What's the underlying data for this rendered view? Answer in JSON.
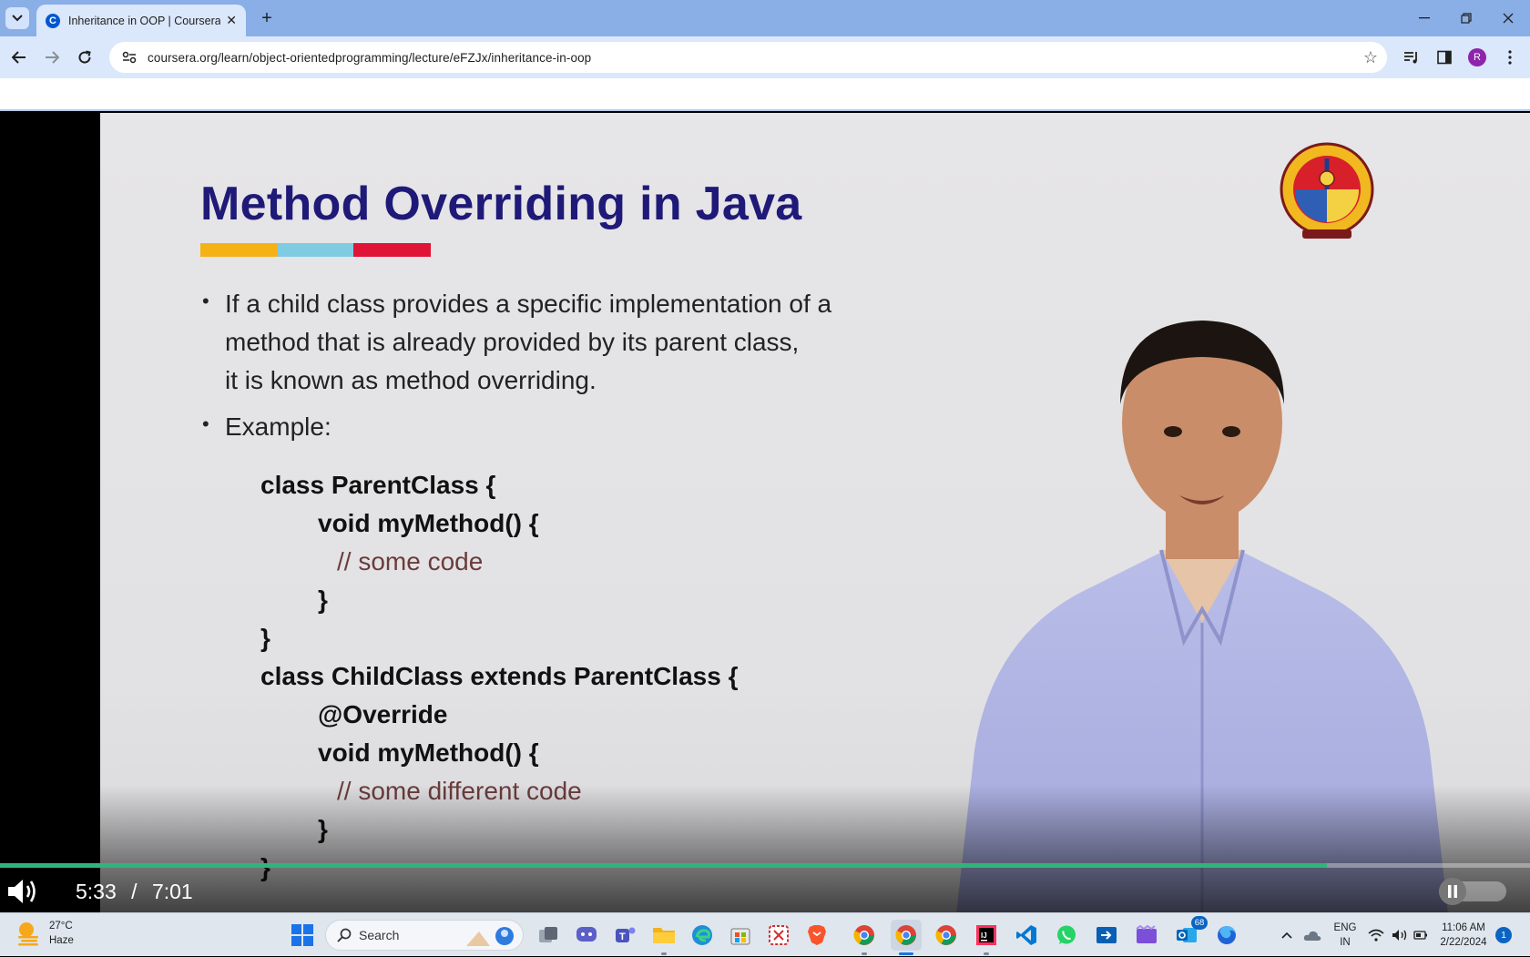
{
  "browser": {
    "tab": {
      "title": "Inheritance in OOP | Coursera",
      "favicon": "coursera-icon"
    },
    "url": "coursera.org/learn/object-orientedprogramming/lecture/eFZJx/inheritance-in-oop",
    "profile_initial": "R",
    "tabstrip_color": "#8aaee6",
    "toolbar_color": "#dbe7fb"
  },
  "slide": {
    "title": "Method Overriding in Java",
    "title_color": "#1f1a78",
    "bullets": [
      {
        "lines": [
          "If a child class provides a specific implementation of a",
          "method that is already provided by its parent class,",
          "it is known as method overriding."
        ]
      },
      {
        "lines": [
          "Example:"
        ]
      }
    ],
    "code": [
      {
        "text": "class ParentClass {",
        "kind": "code"
      },
      {
        "text": "void myMethod() {",
        "kind": "code"
      },
      {
        "text": "// some code",
        "kind": "comment"
      },
      {
        "text": "}",
        "kind": "code"
      },
      {
        "text": "}",
        "kind": "code"
      },
      {
        "text": "class ChildClass extends ParentClass {",
        "kind": "code"
      },
      {
        "text": "@Override",
        "kind": "code"
      },
      {
        "text": "void myMethod() {",
        "kind": "code"
      },
      {
        "text": "// some different code",
        "kind": "comment"
      },
      {
        "text": "}",
        "kind": "code"
      },
      {
        "text": "}",
        "kind": "code"
      }
    ],
    "title_bar_colors": [
      "#f5b215",
      "#7fcbe2",
      "#e01437"
    ]
  },
  "player": {
    "current_time": "5:33",
    "separator": "/",
    "duration": "7:01",
    "progress_fraction": 0.867,
    "progress_color": "#2fb57b"
  },
  "taskbar": {
    "weather": {
      "temp": "27°C",
      "condition": "Haze"
    },
    "search_label": "Search",
    "apps": [
      "windows-start-icon",
      "file-explorer-icon",
      "meet-icon",
      "teams-icon",
      "folder-icon",
      "edge-icon",
      "store-icon",
      "snipping-tool-icon",
      "brave-icon",
      "chrome-icon",
      "chrome-profile-icon",
      "chrome-icon",
      "intellij-icon",
      "vscode-icon",
      "whatsapp-icon",
      "quick-assist-icon",
      "clipchamp-icon",
      "outlook-icon",
      "firefox-icon"
    ],
    "outlook_badge": "68",
    "language": {
      "line1": "ENG",
      "line2": "IN"
    },
    "clock": {
      "time": "11:06 AM",
      "date": "2/22/2024"
    },
    "notification_count": "1"
  }
}
